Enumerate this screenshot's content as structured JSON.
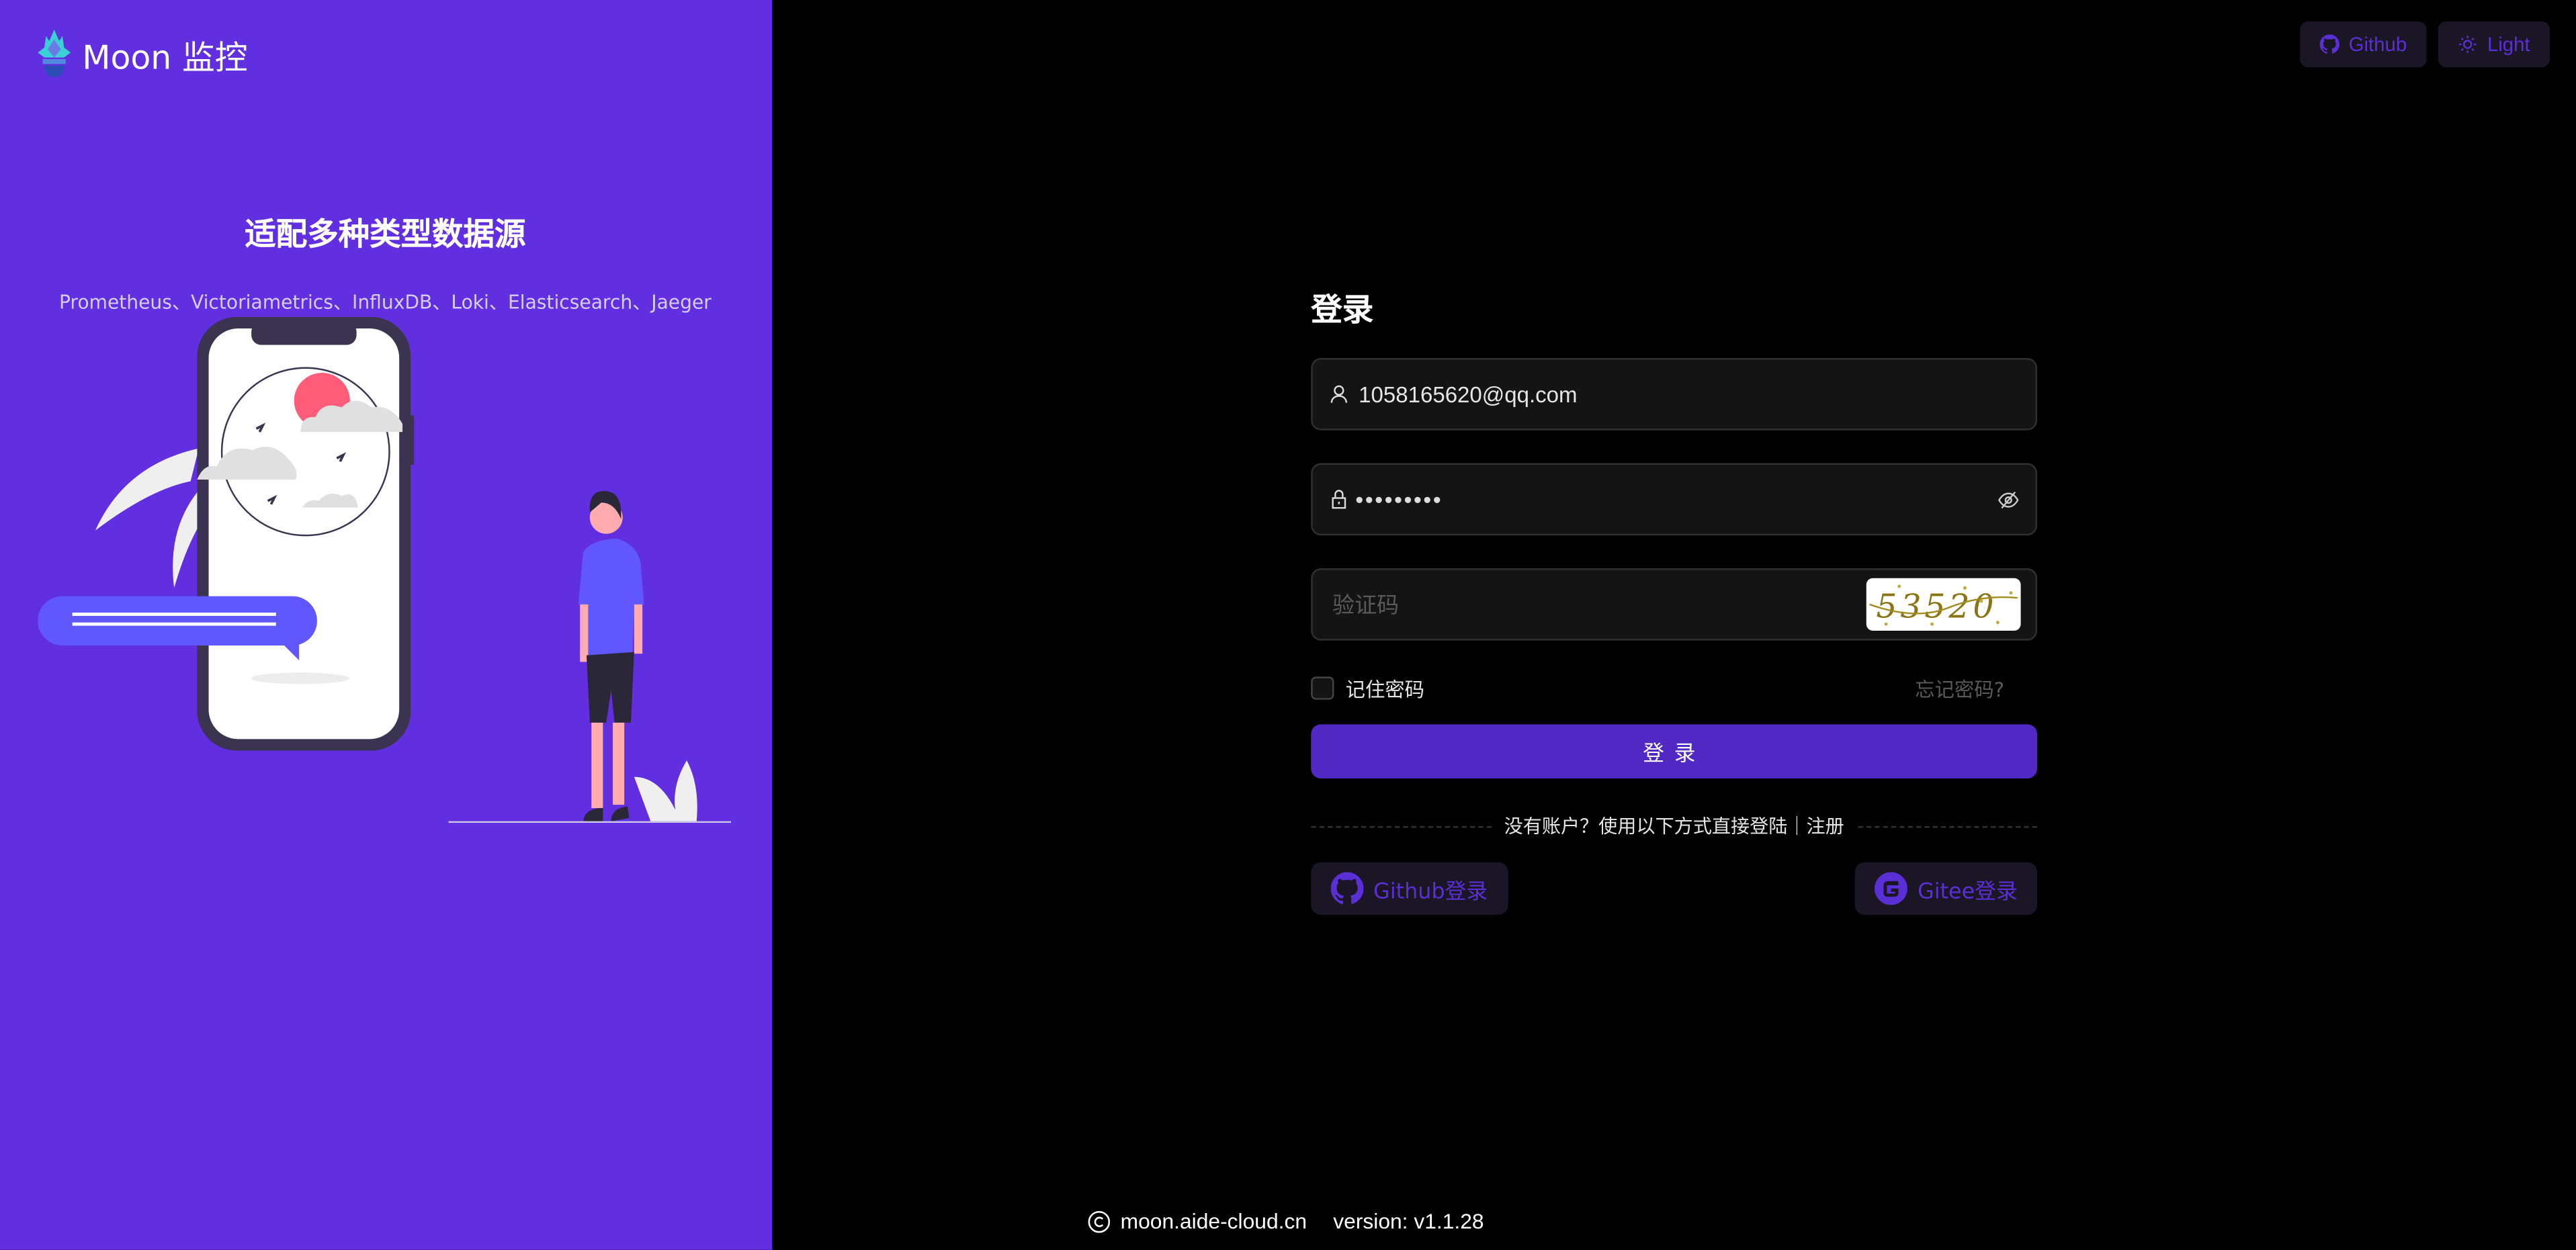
{
  "app": {
    "name": "Moon 监控",
    "logo_icon": "flame-logo-icon"
  },
  "hero": {
    "title": "适配多种类型数据源",
    "subtitle": "Prometheus、Victoriametrics、InfluxDB、Loki、Elasticsearch、Jaeger"
  },
  "top_actions": [
    {
      "label": "Github",
      "icon": "github-icon"
    },
    {
      "label": "Light",
      "icon": "sun-icon"
    }
  ],
  "login": {
    "title": "登录",
    "username": {
      "value": "1058165620@qq.com",
      "icon": "user-icon"
    },
    "password": {
      "value": "•••••••••",
      "icon": "lock-icon",
      "toggle_icon": "eye-invisible-icon"
    },
    "captcha": {
      "value": "",
      "placeholder": "验证码",
      "image_text": "53520"
    },
    "remember_label": "记住密码",
    "remember_checked": false,
    "forgot_label": "忘记密码?",
    "submit_label": "登录",
    "divider_text": "没有账户？使用以下方式直接登陆｜注册",
    "oauth": [
      {
        "label": "Github登录",
        "icon": "github-icon"
      },
      {
        "label": "Gitee登录",
        "icon": "gitee-icon"
      }
    ]
  },
  "footer": {
    "site": "moon.aide-cloud.cn",
    "version": "version: v1.1.28",
    "icon": "copyright-icon"
  },
  "colors": {
    "brand": "#612ee0",
    "primary_button": "#5128c3",
    "accent_text": "#5b2fd6",
    "background": "#000000"
  }
}
